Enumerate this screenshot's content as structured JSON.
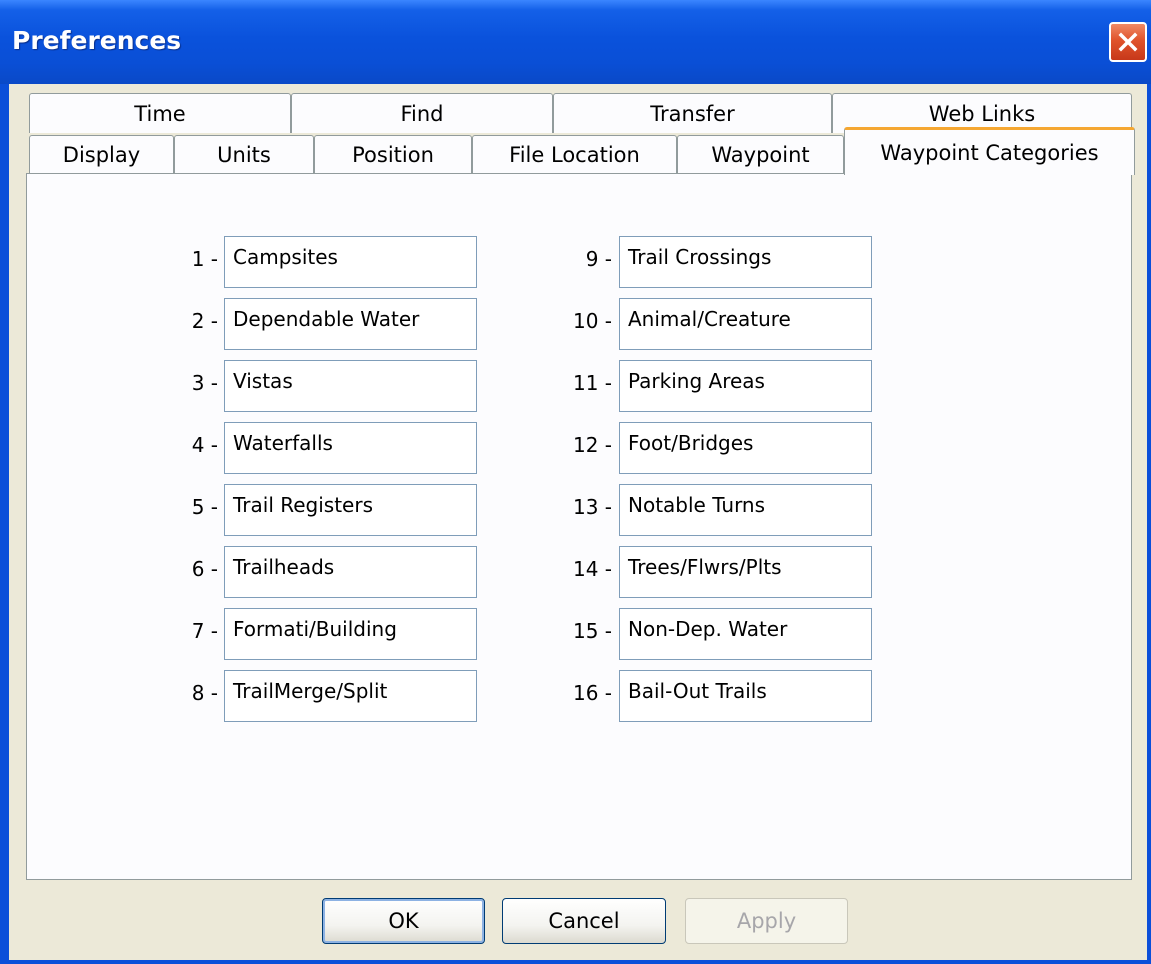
{
  "window": {
    "title": "Preferences"
  },
  "tabs": {
    "row_back": [
      "Time",
      "Find",
      "Transfer",
      "Web Links"
    ],
    "row_front": [
      "Display",
      "Units",
      "Position",
      "File Location",
      "Waypoint",
      "Waypoint Categories"
    ],
    "active": "Waypoint Categories"
  },
  "categories": [
    {
      "num": "1 -",
      "value": "Campsites"
    },
    {
      "num": "2 -",
      "value": "Dependable Water"
    },
    {
      "num": "3 -",
      "value": "Vistas"
    },
    {
      "num": "4 -",
      "value": "Waterfalls"
    },
    {
      "num": "5 -",
      "value": "Trail Registers"
    },
    {
      "num": "6 -",
      "value": "Trailheads"
    },
    {
      "num": "7 -",
      "value": "Formati/Building"
    },
    {
      "num": "8 -",
      "value": "TrailMerge/Split"
    },
    {
      "num": "9 -",
      "value": "Trail Crossings"
    },
    {
      "num": "10 -",
      "value": "Animal/Creature"
    },
    {
      "num": "11 -",
      "value": "Parking Areas"
    },
    {
      "num": "12 -",
      "value": "Foot/Bridges"
    },
    {
      "num": "13 -",
      "value": "Notable Turns"
    },
    {
      "num": "14 -",
      "value": "Trees/Flwrs/Plts"
    },
    {
      "num": "15 -",
      "value": "Non-Dep. Water"
    },
    {
      "num": "16 -",
      "value": "Bail-Out Trails"
    }
  ],
  "buttons": {
    "ok": "OK",
    "cancel": "Cancel",
    "apply": "Apply"
  },
  "colors": {
    "title_bar": "#0a52dc",
    "active_tab_accent": "#f5a732",
    "dialog_bg": "#ece9d8"
  }
}
